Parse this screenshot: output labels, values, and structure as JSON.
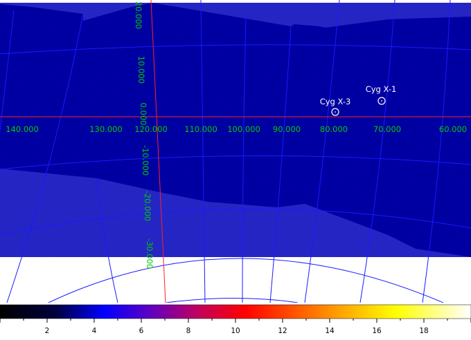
{
  "sky_map": {
    "galactic_longitude_labels": [
      "140.000",
      "130.000",
      "120.000",
      "110.000",
      "100.000",
      "90.000",
      "80.000",
      "70.000",
      "60.000"
    ],
    "galactic_latitude_labels": [
      "20.000",
      "10.000",
      "0.000",
      "-10.000",
      "-20.000",
      "-30.000"
    ],
    "label_color": "#00cc00",
    "grid_color": "#1a1aff",
    "axis_color": "#ff2020",
    "sources": [
      {
        "name": "Cyg X-3",
        "l": 79.8,
        "b": 0.7
      },
      {
        "name": "Cyg X-1",
        "l": 71.3,
        "b": 3.1
      }
    ]
  },
  "colorbar": {
    "tick_labels": [
      "2",
      "4",
      "6",
      "8",
      "10",
      "12",
      "14",
      "16",
      "18"
    ],
    "range": [
      0,
      20
    ]
  }
}
